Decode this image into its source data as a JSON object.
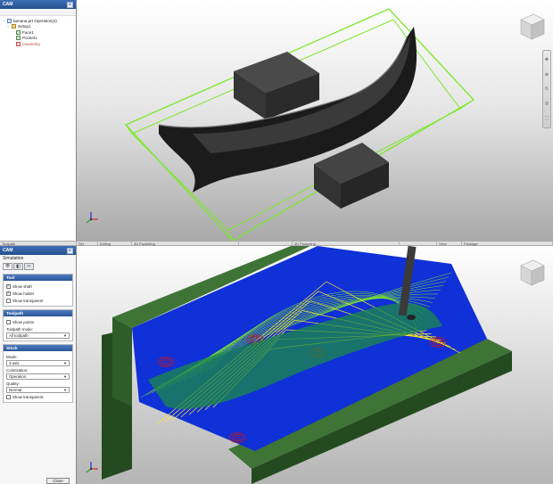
{
  "browser": {
    "title": "CAM",
    "tree": [
      {
        "label": "banana.prt Operation(s)",
        "kind": "root",
        "indent": 0
      },
      {
        "label": "Setup1",
        "kind": "setup",
        "indent": 1
      },
      {
        "label": "Face1",
        "kind": "op",
        "indent": 2
      },
      {
        "label": "Pocket1",
        "kind": "op",
        "indent": 2
      },
      {
        "label": "Geometry",
        "kind": "warn",
        "indent": 2
      }
    ]
  },
  "status": {
    "cells": [
      "Toolpath",
      "Sel",
      "Editing",
      "2D Pocketing",
      "",
      "3D Pocketing",
      "",
      "View",
      "Package"
    ]
  },
  "simulation": {
    "title": "Simulation",
    "tabs": [
      "👁",
      "◧",
      "✂"
    ],
    "tool_group": {
      "title": "Tool",
      "options": [
        {
          "label": "Show shaft",
          "checked": true
        },
        {
          "label": "Show holder",
          "checked": true
        },
        {
          "label": "Show transparent",
          "checked": false
        }
      ]
    },
    "toolpath_group": {
      "title": "Toolpath",
      "show_points_label": "Show points",
      "show_points_checked": false,
      "mode_label": "Toolpath mode:",
      "mode_value": "All toolpath"
    },
    "stock_group": {
      "title": "Stock",
      "mode_label": "Mode:",
      "mode_value": "3 axis",
      "colorization_label": "Colorization:",
      "colorization_value": "Operation",
      "quality_label": "Quality:",
      "quality_value": "Normal",
      "transparent_label": "Show transparent",
      "transparent_checked": false
    },
    "close_label": "Close"
  },
  "colors": {
    "accent": "#2c5596",
    "toolpath_green": "#7be82b",
    "stock_green": "#2f5d2a",
    "toolpath_blue": "#1030d8",
    "toolpath_yellow": "#ffee22",
    "toolpath_red": "#d21414"
  },
  "icons": {
    "view_cube": "view-cube-icon",
    "axis_triad": "axis-triad-icon"
  }
}
